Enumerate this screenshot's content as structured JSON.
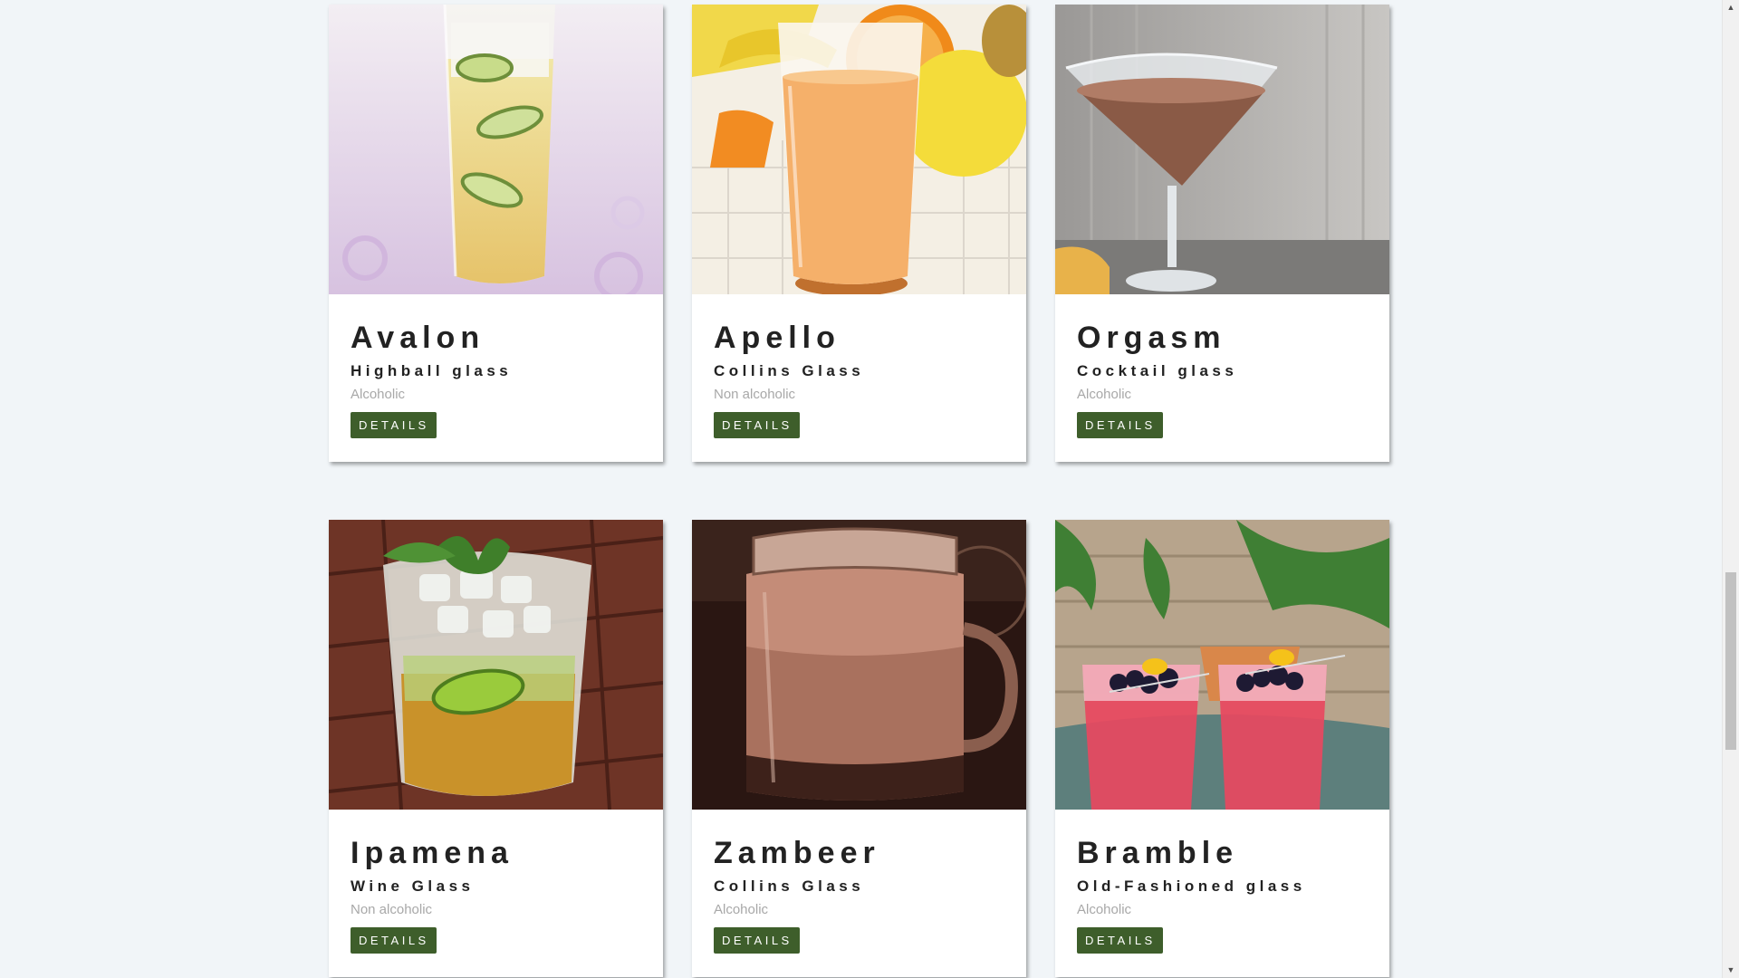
{
  "cards": [
    {
      "name": "Avalon",
      "glass": "Highball glass",
      "type": "Alcoholic",
      "button": "DETAILS",
      "image_icon": "highball-cucumber-drink"
    },
    {
      "name": "Apello",
      "glass": "Collins Glass",
      "type": "Non alcoholic",
      "button": "DETAILS",
      "image_icon": "orange-juice-glass"
    },
    {
      "name": "Orgasm",
      "glass": "Cocktail glass",
      "type": "Alcoholic",
      "button": "DETAILS",
      "image_icon": "martini-glass"
    },
    {
      "name": "Ipamena",
      "glass": "Wine Glass",
      "type": "Non alcoholic",
      "button": "DETAILS",
      "image_icon": "mojito-glass"
    },
    {
      "name": "Zambeer",
      "glass": "Collins Glass",
      "type": "Alcoholic",
      "button": "DETAILS",
      "image_icon": "mason-jar-drink"
    },
    {
      "name": "Bramble",
      "glass": "Old-Fashioned glass",
      "type": "Alcoholic",
      "button": "DETAILS",
      "image_icon": "bramble-glasses"
    }
  ],
  "colors": {
    "page_background": "#f1f5f8",
    "button_background": "#3e5e2b",
    "button_text": "#ffffff",
    "muted_text": "#a8a8a8"
  },
  "scrollbar": {
    "up_icon": "scroll-up-arrow-icon",
    "down_icon": "scroll-down-arrow-icon",
    "scroll_position": 0.72
  }
}
